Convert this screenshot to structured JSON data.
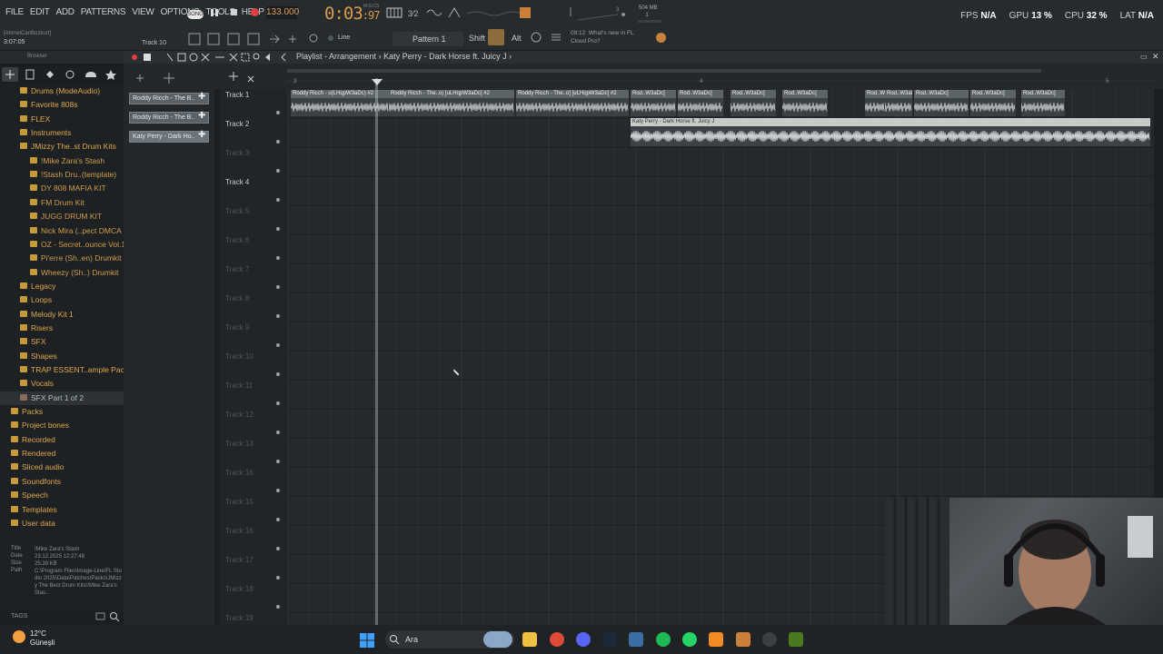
{
  "menu": [
    "FILE",
    "EDIT",
    "ADD",
    "PATTERNS",
    "VIEW",
    "OPTIONS",
    "TOOLS",
    "HELP"
  ],
  "transport": {
    "mode_badge": "SONG",
    "tempo": "133.000",
    "time_main": "0:03",
    "time_sub": ":97",
    "time_unit": "M:S:CS"
  },
  "memory": {
    "value": "504 MB",
    "sub": "1"
  },
  "performance": [
    {
      "label": "FPS",
      "value": "N/A"
    },
    {
      "label": "GPU",
      "value": "13 %"
    },
    {
      "label": "CPU",
      "value": "32 %"
    },
    {
      "label": "LAT",
      "value": "N/A"
    }
  ],
  "toolbar2": {
    "user": "[AhmetCanBozkurt]",
    "time": "3:07:05",
    "track_label": "Track 10",
    "snap_mode": "Line",
    "pattern": "Pattern 1",
    "shift": "Shift",
    "alt": "Alt",
    "news_time": "09:12",
    "news_line1": "What's new in FL",
    "news_line2": "Cloud Pro?"
  },
  "browser": {
    "title": "Browser",
    "items": [
      {
        "label": "Drums (ModeAudio)",
        "type": "folder",
        "indent": 2
      },
      {
        "label": "Favorite 808s",
        "type": "folder",
        "indent": 2
      },
      {
        "label": "FLEX",
        "type": "folder",
        "indent": 2
      },
      {
        "label": "Instruments",
        "type": "folder",
        "indent": 2
      },
      {
        "label": "JMizzy The..st Drum Kits",
        "type": "folder",
        "indent": 2
      },
      {
        "label": "!Mike Zara's Stash",
        "type": "lvl2",
        "indent": 3
      },
      {
        "label": "!Stash Dru..(template)",
        "type": "lvl2",
        "indent": 3
      },
      {
        "label": "DY 808 MAFIA KIT",
        "type": "lvl2",
        "indent": 3
      },
      {
        "label": "FM Drum Kit",
        "type": "lvl2",
        "indent": 3
      },
      {
        "label": "JUGG DRUM KIT",
        "type": "lvl2",
        "indent": 3
      },
      {
        "label": "Nick Mira (..pect DMCA",
        "type": "lvl2",
        "indent": 3
      },
      {
        "label": "OZ - Secret..ounce Vol.1",
        "type": "lvl2",
        "indent": 3
      },
      {
        "label": "Pi'erre (Sh..en) Drumkit",
        "type": "lvl2",
        "indent": 3
      },
      {
        "label": "Wheezy (Sh..) Drumkit",
        "type": "lvl2",
        "indent": 3
      },
      {
        "label": "Legacy",
        "type": "folder",
        "indent": 2
      },
      {
        "label": "Loops",
        "type": "folder",
        "indent": 2
      },
      {
        "label": "Melody Kit 1",
        "type": "folder",
        "indent": 2
      },
      {
        "label": "Risers",
        "type": "folder",
        "indent": 2
      },
      {
        "label": "SFX",
        "type": "folder",
        "indent": 2
      },
      {
        "label": "Shapes",
        "type": "folder",
        "indent": 2
      },
      {
        "label": "TRAP ESSENT..ample Pack]",
        "type": "folder",
        "indent": 2
      },
      {
        "label": "Vocals",
        "type": "folder",
        "indent": 2
      },
      {
        "label": "SFX Part 1 of 2",
        "type": "selected",
        "indent": 2
      },
      {
        "label": "Packs",
        "type": "folder",
        "indent": 1
      },
      {
        "label": "Project bones",
        "type": "folder",
        "indent": 1
      },
      {
        "label": "Recorded",
        "type": "folder",
        "indent": 1
      },
      {
        "label": "Rendered",
        "type": "folder",
        "indent": 1
      },
      {
        "label": "Sliced audio",
        "type": "folder",
        "indent": 1
      },
      {
        "label": "Soundfonts",
        "type": "folder",
        "indent": 1
      },
      {
        "label": "Speech",
        "type": "folder",
        "indent": 1
      },
      {
        "label": "Templates",
        "type": "folder",
        "indent": 1
      },
      {
        "label": "User data",
        "type": "folder",
        "indent": 1
      }
    ],
    "file_info": {
      "title_k": "Title",
      "title_v": "!Mike Zara's Stash",
      "date_k": "Date",
      "date_v": "23.12.2025 12:27:48",
      "size_k": "Size",
      "size_v": "25.39 KB",
      "path_k": "Path",
      "path_v": "C:\\Program Files\\Image-Line\\FL Studio 2025\\Data\\Patches\\Packs\\JMizzy The Best Drum Kits\\!Mike Zara's Stas.."
    },
    "tags": "TAGS"
  },
  "playlist": {
    "breadcrumb": "Playlist - Arrangement",
    "song": "Katy Perry - Dark Horse ft. Juicy J",
    "ruler_marks": [
      "3",
      "4",
      "5"
    ],
    "channels": [
      {
        "label": "Roddy Ricch - The B..",
        "active": false
      },
      {
        "label": "Roddy Ricch - The B..",
        "active": false
      },
      {
        "label": "Katy Perry - Dark Ho..",
        "active": true
      }
    ],
    "tracks": [
      "Track 1",
      "Track 2",
      "Track 3",
      "Track 4",
      "Track 5",
      "Track 6",
      "Track 7",
      "Track 8",
      "Track 9",
      "Track 10",
      "Track 11",
      "Track 12",
      "Track 13",
      "Track 16",
      "Track 15",
      "Track 16",
      "Track 17",
      "Track 18",
      "Track 19"
    ],
    "track_named": [
      true,
      true,
      false,
      true,
      false,
      false,
      false,
      false,
      false,
      false,
      false,
      false,
      false,
      false,
      false,
      false,
      false,
      false,
      false
    ],
    "track1_clips": [
      "Roddy Ricch - u(LHqpW3aDc) #2",
      "Roddy Ricch - The..o) [uLHqpW3aDc] #2",
      "Roddy Ricch - The..o] [uLHqpW3aDc] #2",
      "Rod..W3aDc]",
      "Rod..W3aDc]",
      "Rod..W3aDc]",
      "Rod..W3aDc]",
      "Rod..W3",
      "Rod..W3aDc]",
      "Rod..W3aDc]",
      "Rod..W3aDc]",
      "Rod..W3aDc]"
    ],
    "track2_clip": "Katy Perry - Dark Horse ft. Juicy J"
  },
  "taskbar": {
    "temperature": "12°C",
    "weather": "Güneşli",
    "search": "Ara"
  },
  "colors": {
    "accent_orange": "#d99a4b",
    "folder": "#e0a84a",
    "record": "#e04040"
  }
}
